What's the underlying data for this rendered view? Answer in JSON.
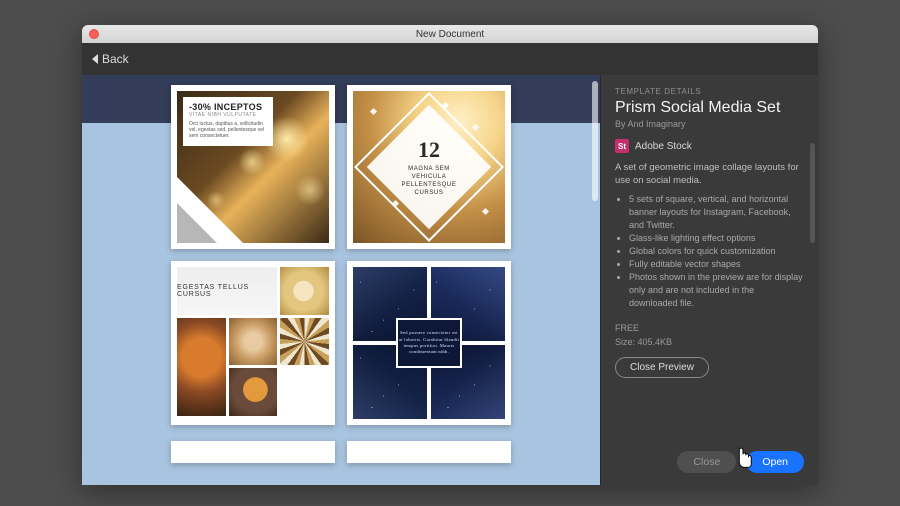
{
  "window": {
    "title": "New Document"
  },
  "toolbar": {
    "back_label": "Back"
  },
  "preview": {
    "tile1": {
      "headline": "-30% INCEPTOS",
      "sub": "VITAE NIBH VULPUTATE",
      "body": "Orci luctus, dapibus a, sollicitudin vel, egestas sed, pellentesque vel sem consectetuer."
    },
    "tile2": {
      "number": "12",
      "caption": "MAGNA SEM\nVEHICULA\nPELLENTESQUE\nCURSUS"
    },
    "tile3": {
      "title": "EGESTAS TELLUS CURSUS"
    },
    "tile4": {
      "center": "Sed posuere consectetur est at lobortis. Curabitur blandit tempus porttitor. Mauris condimentum nibh."
    }
  },
  "details": {
    "section": "TEMPLATE DETAILS",
    "title": "Prism Social Media Set",
    "byline_prefix": "By ",
    "author": "And Imaginary",
    "stock_badge": "St",
    "stock_label": "Adobe Stock",
    "description": "A set of geometric image collage layouts for use on social media.",
    "bullets": [
      "5 sets of square, vertical, and horizontal banner layouts for Instagram, Facebook, and Twitter.",
      "Glass-like lighting effect options",
      "Global colors for quick customization",
      "Fully editable vector shapes",
      "Photos shown in the preview are for display only and are not included in the downloaded file."
    ],
    "price": "FREE",
    "size_label": "Size: 405.4KB",
    "close_preview": "Close Preview",
    "close": "Close",
    "open": "Open"
  }
}
